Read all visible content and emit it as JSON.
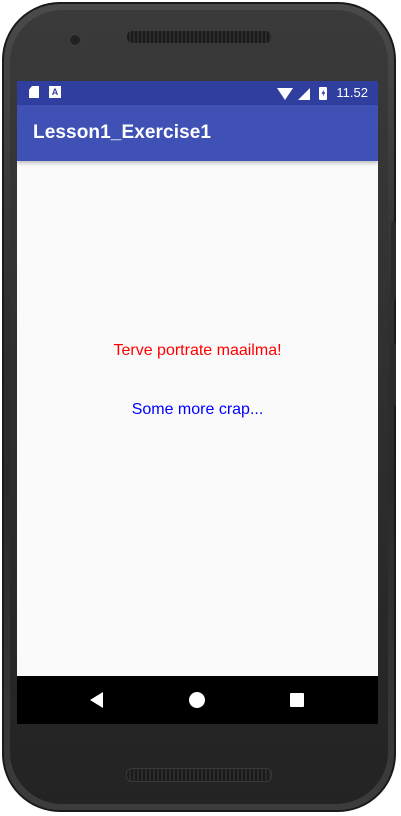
{
  "status_bar": {
    "time": "11.52",
    "notification_icons": [
      "sd-card-icon",
      "a-icon"
    ],
    "system_icons": [
      "wifi-icon",
      "signal-icon",
      "battery-charging-icon"
    ],
    "a_icon_glyph": "A"
  },
  "app_bar": {
    "title": "Lesson1_Exercise1",
    "color": "#3f51b5",
    "status_color": "#303f9f"
  },
  "content": {
    "line1": "Terve portrate maailma!",
    "line1_color": "#ff0000",
    "line2": "Some more crap...",
    "line2_color": "#0000ff"
  },
  "nav_bar": {
    "buttons": [
      "back-icon",
      "home-icon",
      "recents-icon"
    ]
  }
}
